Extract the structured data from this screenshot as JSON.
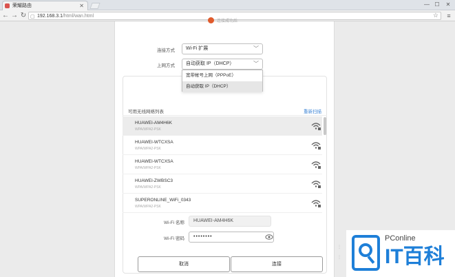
{
  "browser": {
    "tab_title": "荣耀路由",
    "url_host": "192.168.3.1",
    "url_path": "/html/wan.html",
    "window_controls": [
      "—",
      "☐",
      "✕"
    ]
  },
  "header": {
    "note": "连接成功后"
  },
  "form": {
    "mode_label": "连接方式",
    "mode_value": "Wi-Fi 扩展",
    "uplink_label": "上网方式",
    "uplink_value": "自动获取 IP（DHCP）",
    "uplink_options": [
      "宽带帐号上网（PPPoE）",
      "自动获取 IP（DHCP）"
    ]
  },
  "wifi_list": {
    "title": "可用无线网络列表",
    "refresh": "重新扫描",
    "networks": [
      {
        "ssid": "HUAWEI-AM4H6K",
        "security": "WPA/WPA2-PSK"
      },
      {
        "ssid": "HUAWEI-WTCXSA",
        "security": "WPA/WPA2-PSK"
      },
      {
        "ssid": "HUAWEI-WTCXSA",
        "security": "WPA/WPA2-PSK"
      },
      {
        "ssid": "HUAWEI-ZWBSC3",
        "security": "WPA/WPA2-PSK"
      },
      {
        "ssid": "SUPERONLINE_WiFi_0343",
        "security": "WPA/WPA2-PSK"
      }
    ]
  },
  "fields": {
    "name_label": "Wi-Fi 名称",
    "name_value": "HUAWEI-AM4H6K",
    "pw_label": "Wi-Fi 密码",
    "pw_value": "••••••••"
  },
  "buttons": {
    "cancel": "取消",
    "connect": "连接"
  },
  "logo": {
    "brand": "PConline",
    "mark": "IT百科"
  },
  "colors": {
    "accent": "#3f86d6",
    "logo_blue": "#1e7fd8"
  }
}
